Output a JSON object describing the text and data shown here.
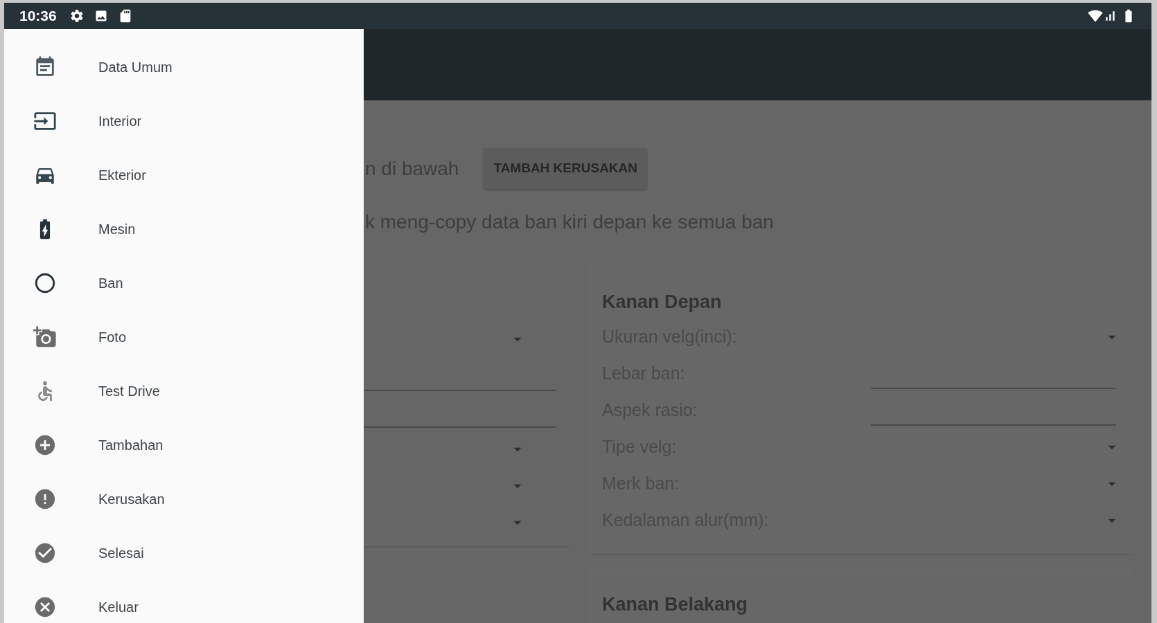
{
  "status_bar": {
    "time": "10:36"
  },
  "drawer": {
    "items": [
      {
        "label": "Data Umum"
      },
      {
        "label": "Interior"
      },
      {
        "label": "Ekterior"
      },
      {
        "label": "Mesin"
      },
      {
        "label": "Ban"
      },
      {
        "label": "Foto"
      },
      {
        "label": "Test Drive"
      },
      {
        "label": "Tambahan"
      },
      {
        "label": "Kerusakan"
      },
      {
        "label": "Selesai"
      },
      {
        "label": "Keluar"
      }
    ]
  },
  "content": {
    "instruction": "n di bawah",
    "add_damage_button": "TAMBAH KERUSAKAN",
    "copy_hint": "k meng-copy data ban kiri depan ke semua ban"
  },
  "left_card": {
    "fields": [
      {
        "kind": "dropdown"
      },
      {
        "kind": "input"
      },
      {
        "kind": "input"
      },
      {
        "kind": "dropdown"
      },
      {
        "kind": "dropdown"
      },
      {
        "kind": "dropdown"
      }
    ]
  },
  "cards": [
    {
      "title": "Kanan Depan",
      "fields": [
        {
          "label": "Ukuran velg(inci):",
          "kind": "dropdown"
        },
        {
          "label": "Lebar ban:",
          "kind": "input"
        },
        {
          "label": "Aspek rasio:",
          "kind": "input"
        },
        {
          "label": "Tipe velg:",
          "kind": "dropdown"
        },
        {
          "label": "Merk ban:",
          "kind": "dropdown"
        },
        {
          "label": "Kedalaman alur(mm):",
          "kind": "dropdown"
        }
      ]
    },
    {
      "title": "Kanan Belakang"
    }
  ]
}
